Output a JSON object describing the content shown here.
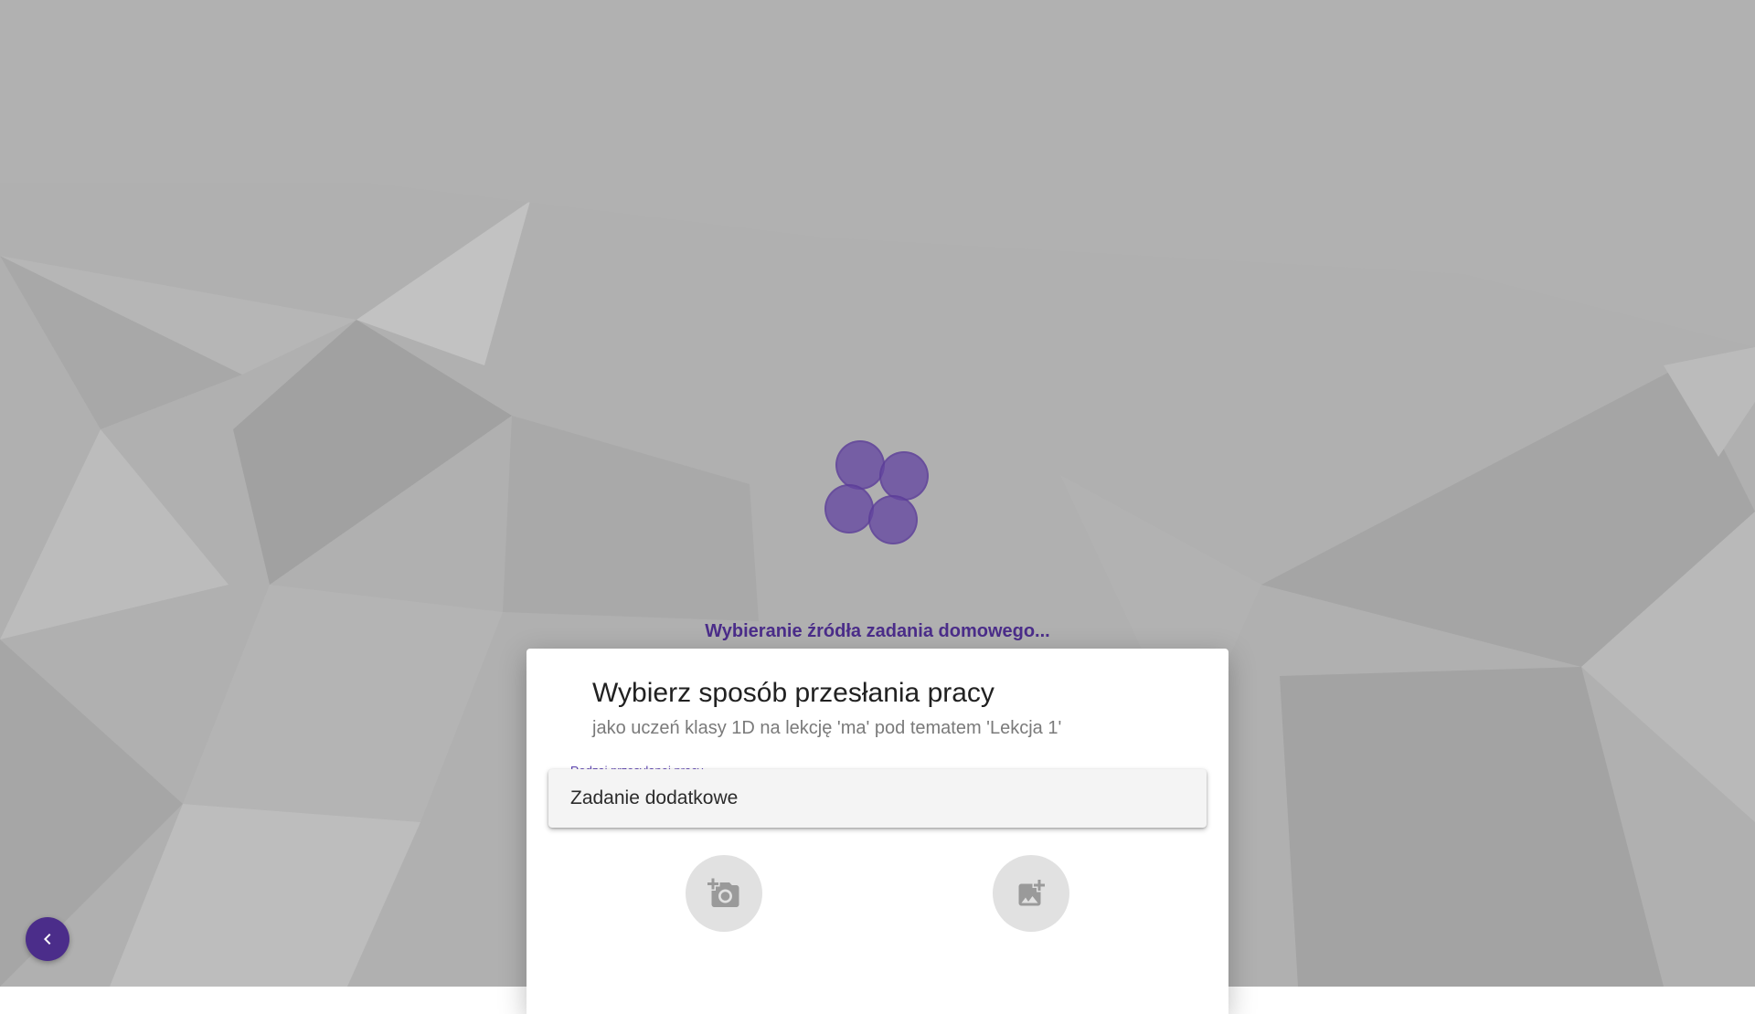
{
  "loading": {
    "text": "Wybieranie źródła zadania domowego..."
  },
  "dialog": {
    "title": "Wybierz sposób przesłania pracy",
    "subtitle": "jako uczeń klasy 1D na lekcję 'ma' pod tematem 'Lekcja 1'",
    "type_field": {
      "label": "Rodzaj przesyłanej pracy",
      "value": "Zadanie dodatkowe"
    },
    "actions": [
      {
        "icon": "add-camera-icon"
      },
      {
        "icon": "add-image-icon"
      }
    ]
  },
  "colors": {
    "accent": "#4b2d8a",
    "loader": "#6446a0",
    "background": "#b0b0b0"
  }
}
